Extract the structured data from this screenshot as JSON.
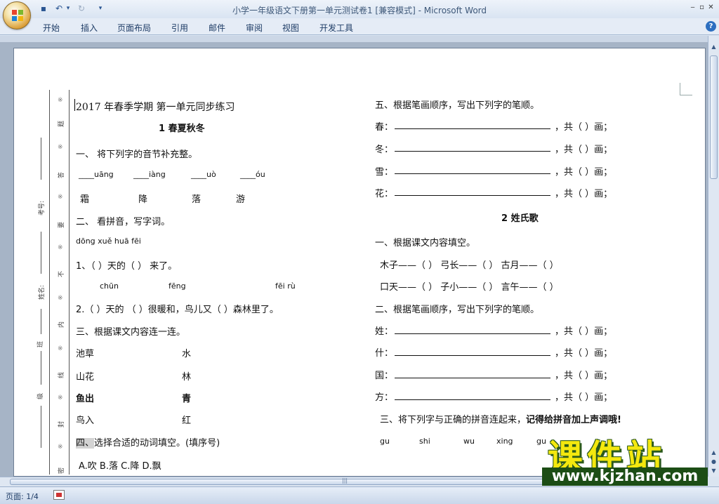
{
  "window": {
    "title": "小学一年级语文下册第一单元测试卷1 [兼容模式] - Microsoft Word",
    "minimize_glyph": "‒",
    "restore_glyph": "▫",
    "close_glyph": "✕"
  },
  "qat": {
    "save_glyph": "▪",
    "undo_glyph": "↶",
    "redo_glyph": "↻",
    "more_glyph": "▾"
  },
  "ribbon": {
    "tabs": [
      "开始",
      "插入",
      "页面布局",
      "引用",
      "邮件",
      "审阅",
      "视图",
      "开发工具"
    ],
    "help_glyph": "?"
  },
  "binding_margin": {
    "labels": [
      "考号:",
      "姓名:",
      "班",
      "级"
    ],
    "between_lines": [
      "题",
      "答",
      "要",
      "不",
      "内",
      "线",
      "封",
      "密"
    ],
    "star": "※"
  },
  "left_column": {
    "header": "2017 年春季学期  第一单元同步练习",
    "lesson1_title": "1   春夏秋冬",
    "q1_title": "一、 将下列字的音节补充整。",
    "q1_pinyin": [
      "____uāng",
      "____iàng",
      "____uò",
      "____óu"
    ],
    "q1_chars": [
      "霜",
      "降",
      "落",
      "游"
    ],
    "q2_title": "二、 看拼音，写字词。",
    "q2_pinyin_row1": "dōng      xuě huā fēi",
    "q2_sentence1": "1、（   ）天的（          ） 来了。",
    "q2_pinyin_row2": [
      "chūn",
      "fēng",
      "fēi rù"
    ],
    "q2_sentence2": "2.（     ）天的 （      ）很暖和，鸟儿又（         ）森林里了。",
    "q3_title": "三、根据课文内容连一连。",
    "q3_pairs": [
      [
        "池草",
        "水"
      ],
      [
        "山花",
        "林"
      ],
      [
        "鱼出",
        "青"
      ],
      [
        "鸟入",
        "红"
      ]
    ],
    "q4_title_hl": "四、",
    "q4_title": "选择合适的动词填空。(填序号)",
    "q4_options": "A.吹    B.落    C.降    D.飘"
  },
  "right_column": {
    "q5_title": "五、根据笔画顺序，写出下列字的笔顺。",
    "q5_chars": [
      "春：",
      "冬：",
      "雪：",
      "花："
    ],
    "stroke_suffix": "，共（    ）画；",
    "lesson2_title": "2   姓氏歌",
    "r_q1_title": "一、根据课文内容填空。",
    "r_q1_row1": "木子——（    ）  弓长——（    ）  古月——（    ）",
    "r_q1_row2": "口天——（    ）  子小——（    ）  言午——（    ）",
    "r_q2_title": "二、根据笔画顺序，写出下列字的笔顺。",
    "r_q2_chars": [
      "姓：",
      "什：",
      "国：",
      "方："
    ],
    "r_q3_title": "三、将下列字与正确的拼音连起来，",
    "r_q3_bold": "记得给拼音加上声调哦!",
    "r_q3_pinyin": [
      "gu",
      "shi",
      "wu",
      "xing",
      "gu"
    ]
  },
  "status": {
    "page": "页面: 1/4"
  },
  "watermark": {
    "logo": "课件站",
    "url": "www.kjzhan.com"
  },
  "colors": {
    "ribbon_bg": "#e5ecf6",
    "doc_bg": "#a6b4c6",
    "watermark_yellow": "#f4e80e",
    "watermark_green": "#1c4d15"
  }
}
